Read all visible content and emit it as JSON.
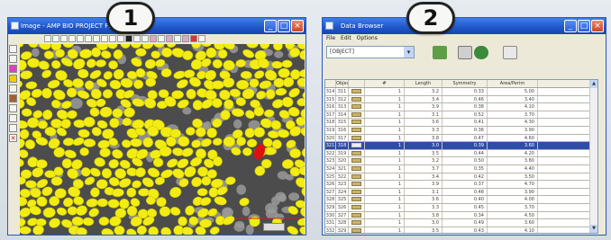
{
  "window1": {
    "title": "Image - AMP BIO PROJECT FILE",
    "controls": [
      "_",
      "□",
      "×"
    ]
  },
  "window2": {
    "title": "Data Browser",
    "controls": [
      "_",
      "□",
      "×"
    ],
    "menu": [
      "File",
      "Edit",
      "Options"
    ],
    "select_value": "[OBJECT]",
    "columns": [
      "",
      "Object",
      "",
      "#",
      "Length",
      "Symmetry",
      "Area/Perim"
    ],
    "rows": [
      {
        "id": "314",
        "obj": "311",
        "n": "1",
        "len": "3.2",
        "sym": "0.33",
        "ap": "5.00"
      },
      {
        "id": "315",
        "obj": "312",
        "n": "1",
        "len": "3.4",
        "sym": "0.46",
        "ap": "3.40"
      },
      {
        "id": "316",
        "obj": "313",
        "n": "1",
        "len": "3.9",
        "sym": "0.38",
        "ap": "4.10"
      },
      {
        "id": "317",
        "obj": "314",
        "n": "1",
        "len": "3.1",
        "sym": "0.52",
        "ap": "3.70"
      },
      {
        "id": "318",
        "obj": "315",
        "n": "1",
        "len": "3.6",
        "sym": "0.41",
        "ap": "4.30"
      },
      {
        "id": "319",
        "obj": "316",
        "n": "1",
        "len": "3.3",
        "sym": "0.36",
        "ap": "3.90"
      },
      {
        "id": "320",
        "obj": "317",
        "n": "1",
        "len": "3.8",
        "sym": "0.47",
        "ap": "4.60"
      },
      {
        "id": "321",
        "obj": "318",
        "n": "1",
        "len": "3.0",
        "sym": "0.39",
        "ap": "3.60"
      },
      {
        "id": "322",
        "obj": "319",
        "n": "1",
        "len": "3.5",
        "sym": "0.44",
        "ap": "4.20"
      },
      {
        "id": "323",
        "obj": "320",
        "n": "1",
        "len": "3.2",
        "sym": "0.50",
        "ap": "3.80"
      },
      {
        "id": "324",
        "obj": "321",
        "n": "1",
        "len": "3.7",
        "sym": "0.35",
        "ap": "4.40"
      },
      {
        "id": "325",
        "obj": "322",
        "n": "1",
        "len": "3.4",
        "sym": "0.42",
        "ap": "3.50"
      },
      {
        "id": "326",
        "obj": "323",
        "n": "1",
        "len": "3.9",
        "sym": "0.37",
        "ap": "4.70"
      },
      {
        "id": "327",
        "obj": "324",
        "n": "1",
        "len": "3.1",
        "sym": "0.48",
        "ap": "3.90"
      },
      {
        "id": "328",
        "obj": "325",
        "n": "1",
        "len": "3.6",
        "sym": "0.40",
        "ap": "4.00"
      },
      {
        "id": "329",
        "obj": "326",
        "n": "1",
        "len": "3.3",
        "sym": "0.45",
        "ap": "3.70"
      },
      {
        "id": "330",
        "obj": "327",
        "n": "1",
        "len": "3.8",
        "sym": "0.34",
        "ap": "4.50"
      },
      {
        "id": "331",
        "obj": "328",
        "n": "1",
        "len": "3.0",
        "sym": "0.49",
        "ap": "3.60"
      },
      {
        "id": "332",
        "obj": "329",
        "n": "1",
        "len": "3.5",
        "sym": "0.43",
        "ap": "4.10"
      }
    ],
    "selected_row": 7
  },
  "badges": [
    "1",
    "2"
  ],
  "colors": {
    "particle": "#f2ec12",
    "particle_stroke": "#c9c200",
    "selected_particle": "#e01010",
    "background_grey": "#9a9a9a",
    "selection_bar": "#2e4f9e",
    "title_blue": "#1f55c7"
  }
}
